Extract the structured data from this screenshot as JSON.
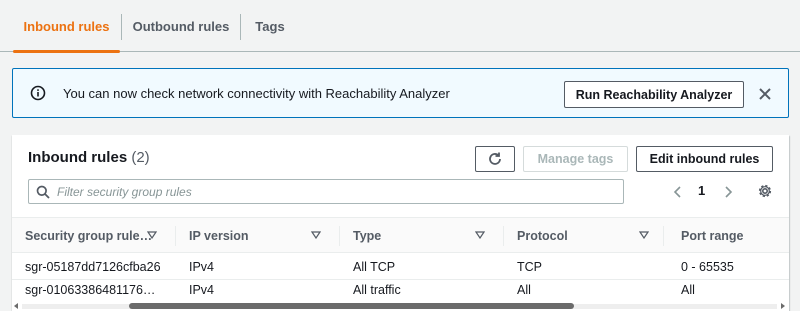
{
  "tabs": [
    {
      "label": "Inbound rules",
      "active": true
    },
    {
      "label": "Outbound rules",
      "active": false
    },
    {
      "label": "Tags",
      "active": false
    }
  ],
  "flash": {
    "type": "info",
    "icon": "info-icon",
    "message": "You can now check network connectivity with Reachability Analyzer",
    "button_label": "Run Reachability Analyzer",
    "close_icon": "close-icon"
  },
  "container": {
    "title": "Inbound rules",
    "count": "(2)",
    "refresh_icon": "refresh-icon",
    "manage_tags_label": "Manage tags",
    "edit_label": "Edit inbound rules",
    "search_placeholder": "Filter security group rules",
    "search_value": "",
    "page": "1"
  },
  "table": {
    "columns": [
      "Security group rule…",
      "IP version",
      "Type",
      "Protocol",
      "Port range"
    ],
    "rows": [
      [
        "sgr-05187dd7126cfba26",
        "IPv4",
        "All TCP",
        "TCP",
        "0 - 65535"
      ],
      [
        "sgr-01063386481176…",
        "IPv4",
        "All traffic",
        "All",
        "All"
      ]
    ]
  },
  "colors": {
    "accent": "#ec7211",
    "info_border": "#0073bb",
    "info_bg": "#f1faff"
  }
}
